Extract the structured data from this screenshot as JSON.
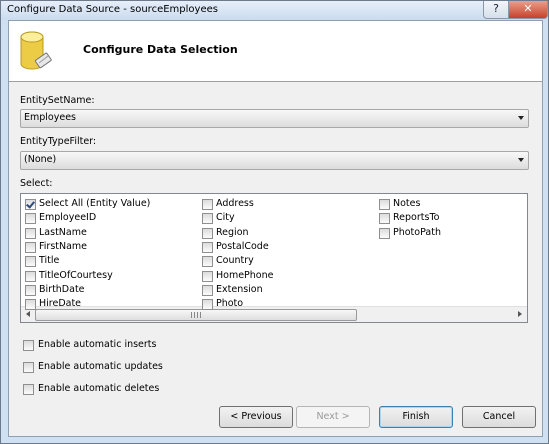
{
  "window": {
    "title": "Configure Data Source - sourceEmployees",
    "help_label": "?",
    "close_label": "✕"
  },
  "banner": {
    "title": "Configure Data Selection"
  },
  "entity_set": {
    "label": "EntitySetName:",
    "value": "Employees"
  },
  "entity_type": {
    "label": "EntityTypeFilter:",
    "value": "(None)"
  },
  "select": {
    "label": "Select:",
    "columns": [
      [
        {
          "label": "Select All (Entity Value)",
          "checked": true
        },
        {
          "label": "EmployeeID",
          "checked": false
        },
        {
          "label": "LastName",
          "checked": false
        },
        {
          "label": "FirstName",
          "checked": false
        },
        {
          "label": "Title",
          "checked": false
        },
        {
          "label": "TitleOfCourtesy",
          "checked": false
        },
        {
          "label": "BirthDate",
          "checked": false
        },
        {
          "label": "HireDate",
          "checked": false
        }
      ],
      [
        {
          "label": "Address",
          "checked": false
        },
        {
          "label": "City",
          "checked": false
        },
        {
          "label": "Region",
          "checked": false
        },
        {
          "label": "PostalCode",
          "checked": false
        },
        {
          "label": "Country",
          "checked": false
        },
        {
          "label": "HomePhone",
          "checked": false
        },
        {
          "label": "Extension",
          "checked": false
        },
        {
          "label": "Photo",
          "checked": false
        }
      ],
      [
        {
          "label": "Notes",
          "checked": false
        },
        {
          "label": "ReportsTo",
          "checked": false
        },
        {
          "label": "PhotoPath",
          "checked": false
        }
      ]
    ]
  },
  "options": {
    "inserts": "Enable automatic inserts",
    "updates": "Enable automatic updates",
    "deletes": "Enable automatic deletes"
  },
  "buttons": {
    "previous": "< Previous",
    "next": "Next >",
    "finish": "Finish",
    "cancel": "Cancel"
  }
}
